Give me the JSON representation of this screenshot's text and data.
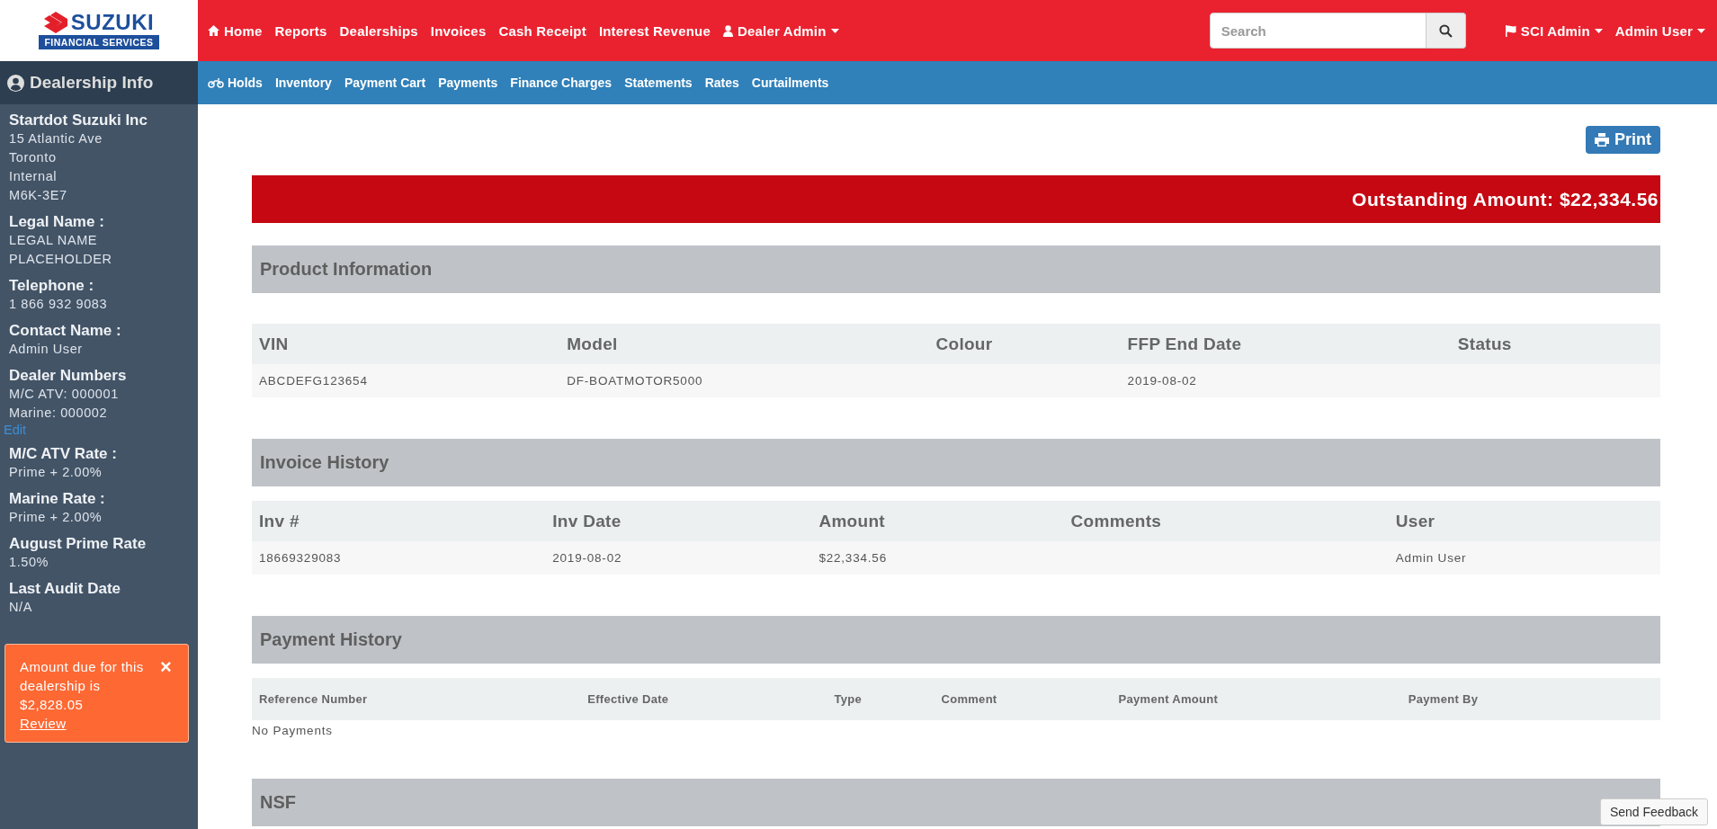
{
  "brand": {
    "name": "SUZUKI",
    "subtitle": "FINANCIAL SERVICES"
  },
  "top_nav": [
    {
      "label": "Home",
      "dropdown": false
    },
    {
      "label": "Reports",
      "dropdown": false
    },
    {
      "label": "Dealerships",
      "dropdown": false
    },
    {
      "label": "Invoices",
      "dropdown": false
    },
    {
      "label": "Cash Receipt",
      "dropdown": false
    },
    {
      "label": "Interest Revenue",
      "dropdown": false
    },
    {
      "label": "Dealer Admin",
      "dropdown": true
    }
  ],
  "search": {
    "placeholder": "Search"
  },
  "user_menu": [
    {
      "label": "SCI Admin",
      "dropdown": true
    },
    {
      "label": "Admin User",
      "dropdown": true
    }
  ],
  "sidebar": {
    "title": "Dealership Info",
    "items": [
      {
        "kind": "field",
        "label": "Startdot Suzuki Inc",
        "values": [
          "15 Atlantic Ave",
          "Toronto",
          "Internal",
          "M6K-3E7"
        ]
      },
      {
        "kind": "field",
        "label": "Legal Name :",
        "values": [
          "LEGAL NAME",
          "PLACEHOLDER"
        ]
      },
      {
        "kind": "field",
        "label": "Telephone :",
        "values": [
          "1 866 932 9083"
        ]
      },
      {
        "kind": "field",
        "label": "Contact Name :",
        "values": [
          "Admin User"
        ]
      },
      {
        "kind": "field",
        "label": "Dealer Numbers",
        "values": [
          "M/C ATV: 000001",
          "Marine: 000002"
        ]
      },
      {
        "kind": "link",
        "label": "Edit"
      },
      {
        "kind": "field",
        "label": "M/C ATV Rate :",
        "values": [
          "Prime + 2.00%"
        ]
      },
      {
        "kind": "field",
        "label": "Marine Rate :",
        "values": [
          "Prime + 2.00%"
        ]
      },
      {
        "kind": "field",
        "label": "August Prime Rate",
        "values": [
          "1.50%"
        ]
      },
      {
        "kind": "field",
        "label": "Last Audit Date",
        "values": [
          "N/A"
        ]
      }
    ],
    "alert": {
      "message": "Amount due for this dealership is $2,828.05",
      "link": "Review",
      "close": "×"
    }
  },
  "sub_nav": [
    {
      "label": "Holds"
    },
    {
      "label": "Inventory"
    },
    {
      "label": "Payment Cart"
    },
    {
      "label": "Payments"
    },
    {
      "label": "Finance Charges"
    },
    {
      "label": "Statements"
    },
    {
      "label": "Rates"
    },
    {
      "label": "Curtailments"
    }
  ],
  "print_button": "Print",
  "outstanding": "Outstanding Amount: $22,334.56",
  "sections": [
    {
      "title": "Product Information",
      "columns": [
        "VIN",
        "Model",
        "Colour",
        "FFP End Date",
        "Status"
      ],
      "rows": [
        [
          "ABCDEFG123654",
          "DF-BOATMOTOR5000",
          "",
          "2019-08-02",
          ""
        ]
      ]
    },
    {
      "title": "Invoice History",
      "columns": [
        "Inv #",
        "Inv Date",
        "Amount",
        "Comments",
        "User"
      ],
      "rows": [
        [
          "18669329083",
          "2019-08-02",
          "$22,334.56",
          "",
          "Admin User"
        ]
      ]
    },
    {
      "title": "Payment History",
      "columns": [
        "Reference Number",
        "Effective Date",
        "Type",
        "Comment",
        "Payment Amount",
        "Payment By"
      ],
      "empty_text": "No Payments"
    },
    {
      "title": "NSF"
    }
  ],
  "feedback_button": "Send Feedback"
}
